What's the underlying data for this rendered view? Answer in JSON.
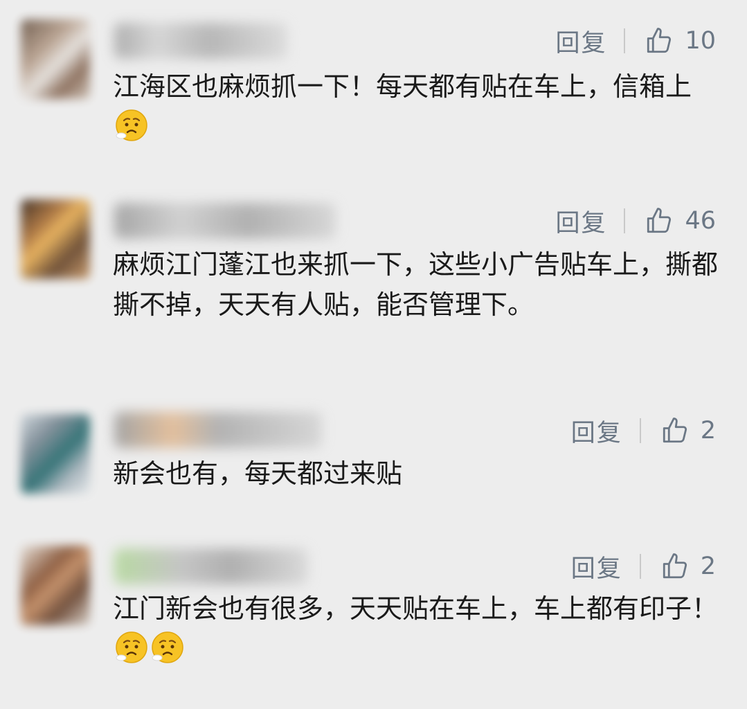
{
  "ui": {
    "reply_label": "回复"
  },
  "comments": [
    {
      "likes": "10",
      "text": "江海区也麻烦抓一下！每天都有贴在车上，信箱上",
      "emojis": [
        "worried-face-icon"
      ]
    },
    {
      "likes": "46",
      "text": "麻烦江门蓬江也来抓一下，这些小广告贴车上，撕都撕不掉，天天有人贴，能否管理下。",
      "emojis": []
    },
    {
      "likes": "2",
      "text": "新会也有，每天都过来贴",
      "emojis": []
    },
    {
      "likes": "2",
      "text": "江门新会也有很多，天天贴在车上，车上都有印子！",
      "emojis": [
        "worried-face-icon",
        "worried-face-icon"
      ]
    }
  ],
  "colors": {
    "background": "#ededed",
    "action_text": "#6b7785",
    "comment_text": "#1a1a1a",
    "emoji_fill": "#f7c325"
  }
}
